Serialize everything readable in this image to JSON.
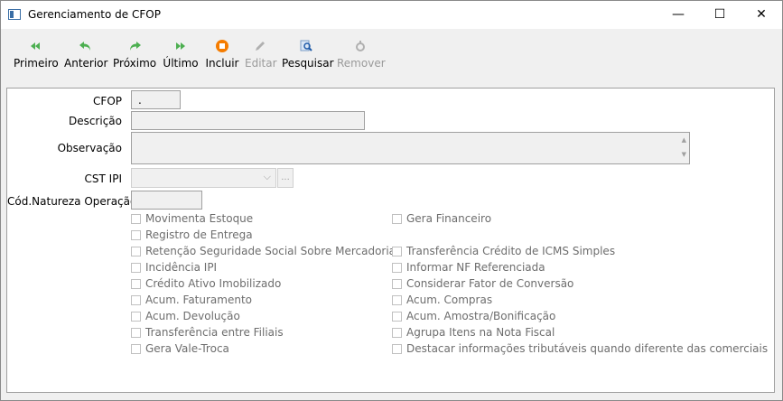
{
  "window": {
    "title": "Gerenciamento de CFOP",
    "minimize": "—",
    "maximize": "☐",
    "close": "✕"
  },
  "toolbar": {
    "first": "Primeiro",
    "prev": "Anterior",
    "next": "Próximo",
    "last": "Último",
    "add": "Incluir",
    "edit": "Editar",
    "search": "Pesquisar",
    "remove": "Remover"
  },
  "form": {
    "cfop_label": "CFOP",
    "cfop_value": ".",
    "descricao_label": "Descrição",
    "descricao_value": "",
    "observacao_label": "Observação",
    "observacao_value": "",
    "cst_ipi_label": "CST IPI",
    "cst_ipi_value": "",
    "cst_ipi_browse": "...",
    "natureza_label": "Cód.Natureza Operação",
    "natureza_value": ""
  },
  "checkboxes_left": [
    {
      "label": "Movimenta Estoque",
      "checked": false
    },
    {
      "label": "Registro de Entrega",
      "checked": false
    },
    {
      "label": "Retenção Seguridade Social Sobre Mercadorias",
      "checked": false
    },
    {
      "label": "Incidência IPI",
      "checked": false
    },
    {
      "label": "Crédito Ativo Imobilizado",
      "checked": false
    },
    {
      "label": "Acum. Faturamento",
      "checked": false
    },
    {
      "label": "Acum. Devolução",
      "checked": false
    },
    {
      "label": "Transferência entre Filiais",
      "checked": false
    },
    {
      "label": "Gera Vale-Troca",
      "checked": false
    }
  ],
  "checkboxes_right": [
    {
      "label": "Gera Financeiro",
      "checked": false
    },
    {
      "label": "Transferência Crédito de ICMS Simples",
      "checked": false
    },
    {
      "label": "Informar NF Referenciada",
      "checked": false
    },
    {
      "label": "Considerar Fator de Conversão",
      "checked": false
    },
    {
      "label": "Acum. Compras",
      "checked": false
    },
    {
      "label": "Acum. Amostra/Bonificação",
      "checked": false
    },
    {
      "label": "Agrupa Itens na Nota Fiscal",
      "checked": false
    },
    {
      "label": "Destacar informações tributáveis quando diferente das comerciais",
      "checked": false
    }
  ]
}
